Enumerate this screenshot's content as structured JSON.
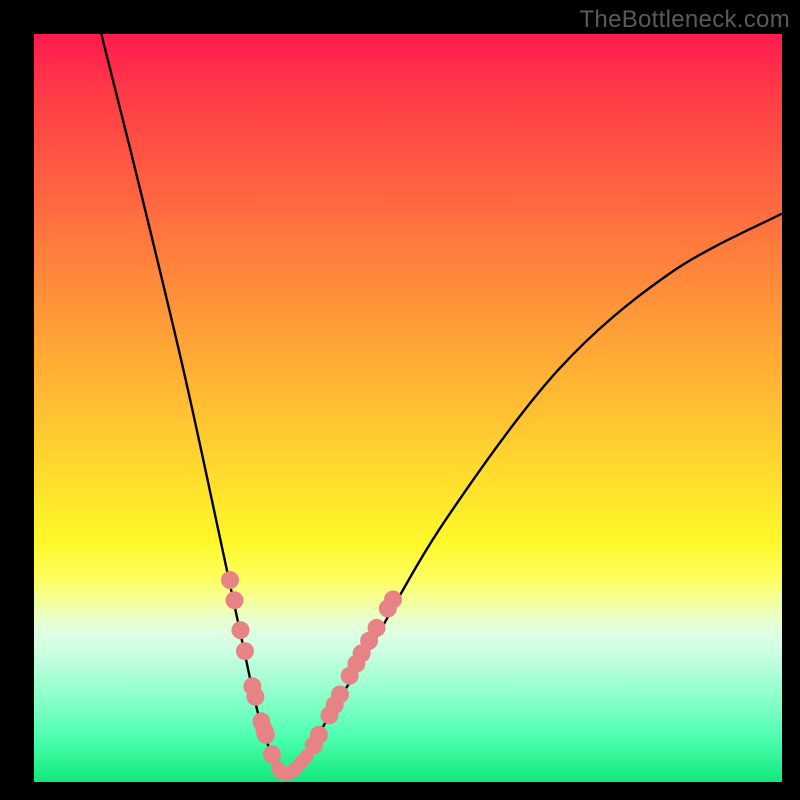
{
  "watermark": "TheBottleneck.com",
  "chart_data": {
    "type": "line",
    "title": "",
    "xlabel": "",
    "ylabel": "",
    "xlim": [
      0,
      100
    ],
    "ylim": [
      0,
      100
    ],
    "optimum_x": 33,
    "curve": [
      {
        "x": 9,
        "y": 100
      },
      {
        "x": 14,
        "y": 80
      },
      {
        "x": 20,
        "y": 55
      },
      {
        "x": 25,
        "y": 32
      },
      {
        "x": 28,
        "y": 18
      },
      {
        "x": 30,
        "y": 9
      },
      {
        "x": 32,
        "y": 3
      },
      {
        "x": 33,
        "y": 1
      },
      {
        "x": 34,
        "y": 1
      },
      {
        "x": 36,
        "y": 3
      },
      {
        "x": 39,
        "y": 8
      },
      {
        "x": 45,
        "y": 18
      },
      {
        "x": 55,
        "y": 35
      },
      {
        "x": 70,
        "y": 55
      },
      {
        "x": 85,
        "y": 68
      },
      {
        "x": 100,
        "y": 76
      }
    ],
    "markers_left": [
      {
        "x": 26.2,
        "y": 27.0
      },
      {
        "x": 26.8,
        "y": 24.3
      },
      {
        "x": 27.6,
        "y": 20.3
      },
      {
        "x": 28.2,
        "y": 17.5
      },
      {
        "x": 29.2,
        "y": 12.8
      },
      {
        "x": 29.6,
        "y": 11.4
      },
      {
        "x": 30.4,
        "y": 8.1
      },
      {
        "x": 30.8,
        "y": 6.9
      },
      {
        "x": 31.0,
        "y": 6.3
      },
      {
        "x": 31.8,
        "y": 3.7
      }
    ],
    "markers_bottom": [
      {
        "x": 32.6,
        "y": 1.9
      },
      {
        "x": 33.0,
        "y": 1.3
      },
      {
        "x": 33.7,
        "y": 1.1
      },
      {
        "x": 34.3,
        "y": 1.3
      },
      {
        "x": 35.0,
        "y": 1.8
      },
      {
        "x": 35.7,
        "y": 2.6
      },
      {
        "x": 36.4,
        "y": 3.4
      }
    ],
    "markers_right": [
      {
        "x": 37.4,
        "y": 4.9
      },
      {
        "x": 38.1,
        "y": 6.3
      },
      {
        "x": 39.5,
        "y": 8.9
      },
      {
        "x": 40.2,
        "y": 10.3
      },
      {
        "x": 40.9,
        "y": 11.7
      },
      {
        "x": 42.2,
        "y": 14.2
      },
      {
        "x": 43.1,
        "y": 15.8
      },
      {
        "x": 43.8,
        "y": 17.2
      },
      {
        "x": 44.8,
        "y": 18.9
      },
      {
        "x": 45.8,
        "y": 20.6
      },
      {
        "x": 47.3,
        "y": 23.2
      },
      {
        "x": 48.0,
        "y": 24.4
      }
    ],
    "marker_radius_large": 9,
    "marker_radius_small": 7,
    "marker_color": "#e78385",
    "curve_color": "#000000"
  }
}
